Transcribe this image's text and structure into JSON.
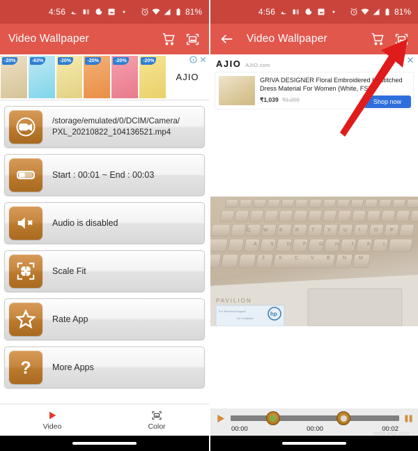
{
  "status_bar": {
    "time": "4:56",
    "battery": "81%",
    "icons": [
      "notification-icon",
      "cast-icon",
      "do-not-disturb-icon",
      "photo-notification-icon",
      "dot-icon"
    ],
    "right_icons": [
      "alarm-icon",
      "wifi-icon",
      "signal-icon",
      "battery-icon"
    ]
  },
  "left_screen": {
    "toolbar": {
      "title": "Video Wallpaper",
      "cart_icon": "shopping-cart-icon",
      "wallpaper_icon": "set-wallpaper-icon"
    },
    "ad_banner": {
      "brand": "AJIO",
      "info_icon": "info-icon",
      "close_icon": "close-icon",
      "thumbs": [
        {
          "discount": "-20%",
          "c1": "#e8dcc0",
          "c2": "#d8c79a"
        },
        {
          "discount": "-63%",
          "c1": "#79d4e8",
          "c2": "#8fe0ef"
        },
        {
          "discount": "-20%",
          "c1": "#f2e6a8",
          "c2": "#e4d487"
        },
        {
          "discount": "-20%",
          "c1": "#f0a460",
          "c2": "#e88f49"
        },
        {
          "discount": "-20%",
          "c1": "#f08fa0",
          "c2": "#ea7a8f"
        },
        {
          "discount": "-20%",
          "c1": "#f5e08a",
          "c2": "#ebd06a"
        }
      ]
    },
    "list": [
      {
        "icon": "video-camera-icon",
        "label": "/storage/emulated/0/DCIM/Camera/\nPXL_20210822_104136521.mp4",
        "small": true
      },
      {
        "icon": "trim-range-icon",
        "label": "Start : 00:01 ~ End : 00:03",
        "small": false
      },
      {
        "icon": "mute-speaker-icon",
        "label": "Audio is disabled",
        "small": false
      },
      {
        "icon": "scale-fit-icon",
        "label": "Scale Fit",
        "small": false
      },
      {
        "icon": "star-icon",
        "label": "Rate App",
        "small": false
      },
      {
        "icon": "question-mark-icon",
        "label": "More Apps",
        "small": false
      }
    ],
    "bottom_nav": [
      {
        "icon": "play-triangle-icon",
        "label": "Video"
      },
      {
        "icon": "color-frame-icon",
        "label": "Color"
      }
    ]
  },
  "right_screen": {
    "toolbar": {
      "back_icon": "back-arrow-icon",
      "title": "Video Wallpaper",
      "cart_icon": "shopping-cart-icon",
      "wallpaper_icon": "set-wallpaper-icon"
    },
    "ad": {
      "brand": "AJIO",
      "site": "AJIO.com",
      "info_icon": "info-icon",
      "close_icon": "close-icon",
      "title": "GRIVA DESIGNER Floral Embroidered Unstitched Dress Material For Women (White, FS)",
      "price": "₹1,039",
      "old_price": "₹1,299",
      "cta": "Shop now"
    },
    "player": {
      "play_icon": "play-icon",
      "pause_icon": "pause-icon",
      "start_time": "00:00",
      "current_time": "00:00",
      "end_time": "00:02",
      "watermark": "www.ajio.com"
    },
    "annotation": {
      "arrow": "red-arrow-pointing-to-wallpaper-icon",
      "color": "#e01b1b"
    }
  },
  "colors": {
    "status_bar": "#c9453c",
    "toolbar": "#e2574c",
    "icon_orange": "#b97a2e",
    "accent_blue": "#2f6fdd"
  }
}
